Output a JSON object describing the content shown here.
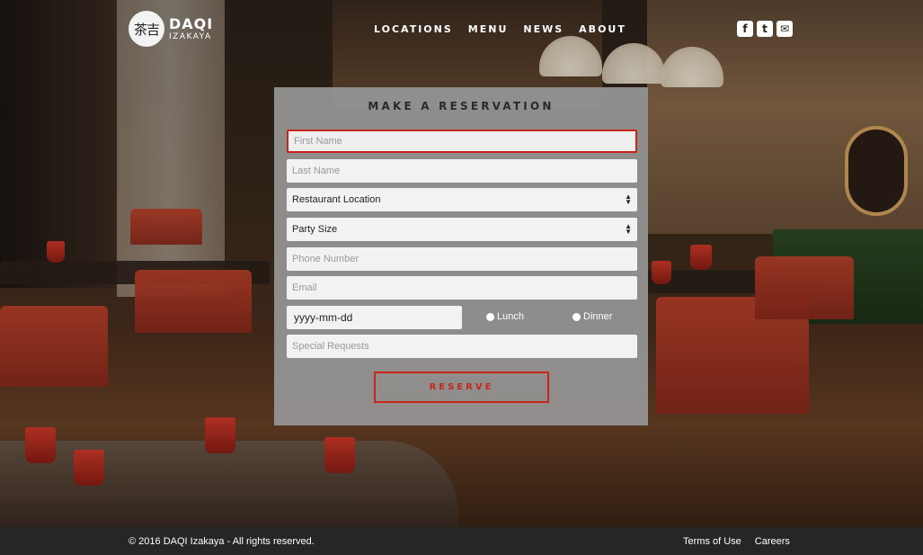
{
  "brand": {
    "logo_glyph": "茶吉",
    "name": "DAQI",
    "sub": "IZAKAYA"
  },
  "nav": {
    "items": [
      "LOCATIONS",
      "MENU",
      "NEWS",
      "ABOUT"
    ]
  },
  "social": {
    "items": [
      {
        "icon": "facebook-icon",
        "glyph": "f"
      },
      {
        "icon": "twitter-icon",
        "glyph": "t"
      },
      {
        "icon": "envelope-icon",
        "glyph": "✉"
      }
    ]
  },
  "form": {
    "title": "MAKE A RESERVATION",
    "first_name_placeholder": "First Name",
    "last_name_placeholder": "Last Name",
    "location_selected": "Restaurant Location",
    "party_size_selected": "Party Size",
    "phone_placeholder": "Phone Number",
    "email_placeholder": "Email",
    "date_value": "yyyy-mm-dd",
    "lunch_label": "Lunch",
    "dinner_label": "Dinner",
    "requests_placeholder": "Special Requests",
    "submit_label": "RESERVE"
  },
  "footer": {
    "copyright": "© 2016 DAQI Izakaya - All rights reserved.",
    "links": [
      "Terms of Use",
      "Careers"
    ]
  },
  "colors": {
    "accent": "#c8261c",
    "panel": "#969696",
    "footer": "#262626"
  }
}
